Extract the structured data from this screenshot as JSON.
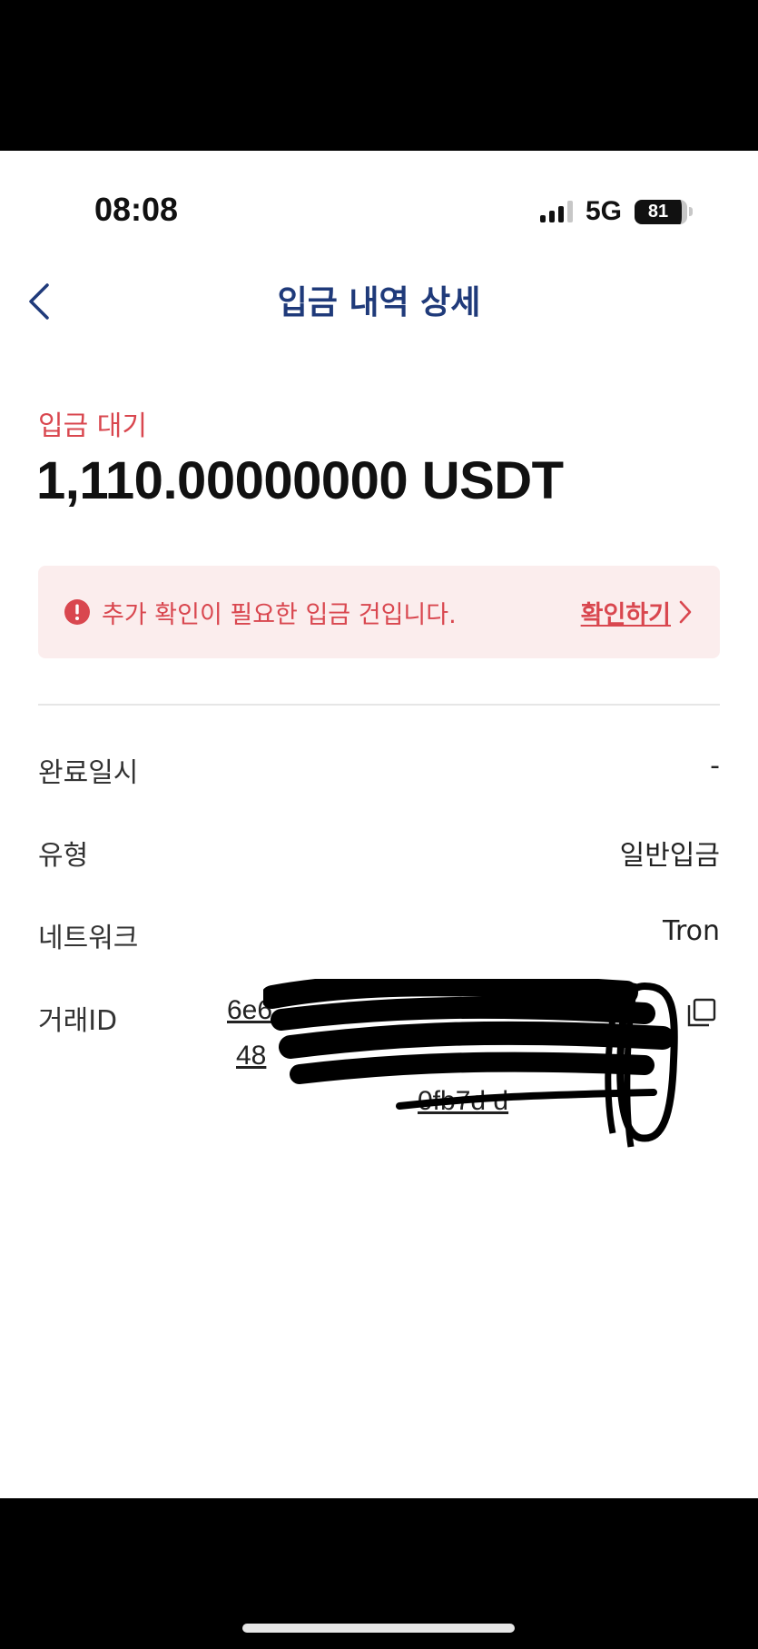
{
  "status_bar": {
    "time": "08:08",
    "network": "5G",
    "battery": "81"
  },
  "header": {
    "title": "입금 내역 상세"
  },
  "deposit": {
    "status": "입금 대기",
    "amount": "1,110.00000000 USDT"
  },
  "notice": {
    "message": "추가 확인이 필요한 입금 건입니다.",
    "link_label": "확인하기"
  },
  "details": {
    "completed_at": {
      "label": "완료일시",
      "value": "-"
    },
    "type": {
      "label": "유형",
      "value": "일반입금"
    },
    "network": {
      "label": "네트워크",
      "value": "Tron"
    },
    "tx_id": {
      "label": "거래ID",
      "lines": [
        "6e6",
        "48",
        "0fb7d            d"
      ]
    }
  },
  "colors": {
    "accent_red": "#d9474f",
    "title_blue": "#1f3a7a",
    "notice_bg": "#fbeded"
  }
}
